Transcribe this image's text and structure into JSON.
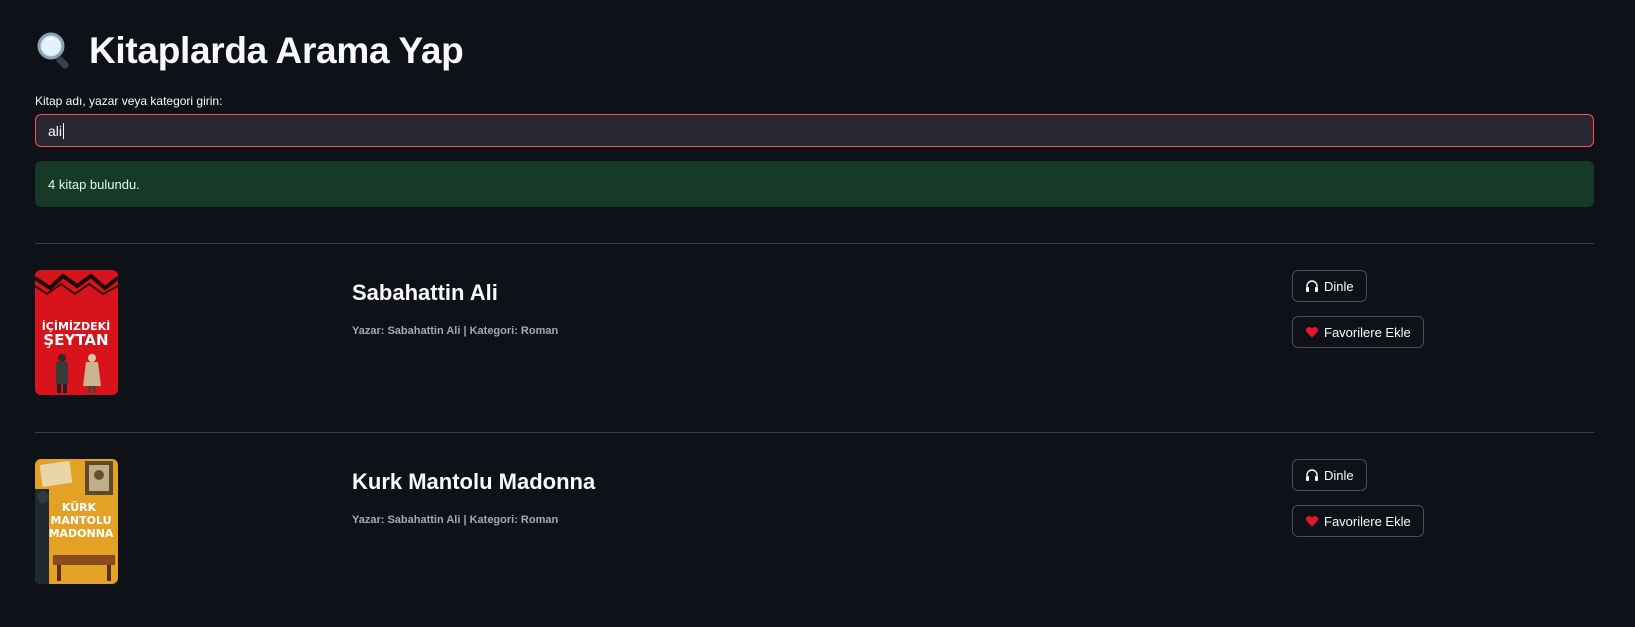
{
  "header": {
    "title": "Kitaplarda Arama Yap",
    "icon": "magnifier-icon"
  },
  "search": {
    "label": "Kitap adı, yazar veya kategori girin:",
    "value": "ali"
  },
  "result_alert": {
    "text": "4 kitap bulundu.",
    "color": "#173928"
  },
  "books": [
    {
      "title": "Sabahattin Ali",
      "meta": "Yazar: Sabahattin Ali | Kategori: Roman",
      "cover_text_1": "İÇİMİZDEKİ",
      "cover_text_2": "ŞEYTAN",
      "listen_label": "Dinle",
      "fav_label": "Favorilere Ekle"
    },
    {
      "title": "Kurk Mantolu Madonna",
      "meta": "Yazar: Sabahattin Ali | Kategori: Roman",
      "cover_text_1": "KÜRK",
      "cover_text_2": "MANTOLU",
      "cover_text_3": "MADONNA",
      "listen_label": "Dinle",
      "fav_label": "Favorilere Ekle"
    }
  ],
  "colors": {
    "background": "#0e1117",
    "input_bg": "#262730",
    "focus_border": "#ff4b4b",
    "success_bg": "#173928"
  }
}
